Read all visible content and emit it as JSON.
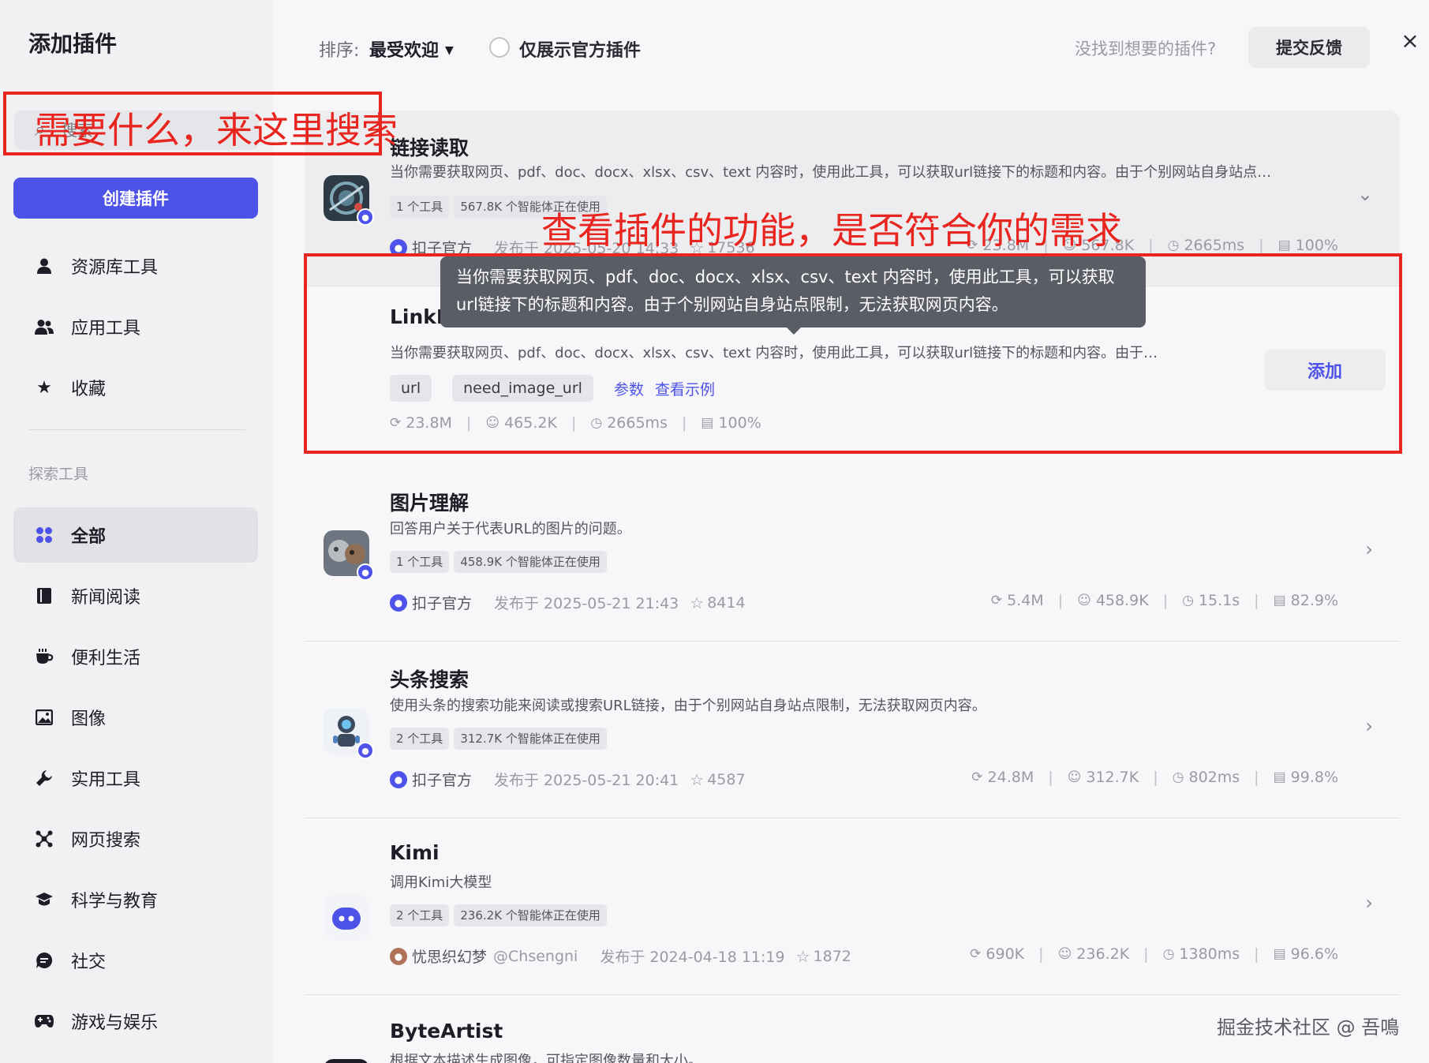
{
  "sidebar": {
    "title": "添加插件",
    "search_placeholder": "搜索",
    "create_button": "创建插件",
    "top_items": [
      {
        "label": "资源库工具",
        "icon": "user-icon"
      },
      {
        "label": "应用工具",
        "icon": "users-icon"
      },
      {
        "label": "收藏",
        "icon": "star-icon"
      }
    ],
    "section_label": "探索工具",
    "categories": [
      {
        "label": "全部",
        "icon": "grid-icon",
        "active": true
      },
      {
        "label": "新闻阅读",
        "icon": "book-icon"
      },
      {
        "label": "便利生活",
        "icon": "cup-icon"
      },
      {
        "label": "图像",
        "icon": "image-icon"
      },
      {
        "label": "实用工具",
        "icon": "wrench-icon"
      },
      {
        "label": "网页搜索",
        "icon": "network-icon"
      },
      {
        "label": "科学与教育",
        "icon": "graduation-cap-icon"
      },
      {
        "label": "社交",
        "icon": "chat-icon"
      },
      {
        "label": "游戏与娱乐",
        "icon": "gamepad-icon"
      }
    ]
  },
  "toolbar": {
    "sort_label": "排序:",
    "sort_value": "最受欢迎",
    "official_only": "仅展示官方插件",
    "not_found": "没找到想要的插件?",
    "feedback": "提交反馈",
    "close": "×"
  },
  "plugins": [
    {
      "title": "链接读取",
      "desc": "当你需要获取网页、pdf、doc、docx、xlsx、csv、text 内容时，使用此工具，可以获取url链接下的标题和内容。由于个别网站自身站点…",
      "tools": "1 个工具",
      "usage": "567.8K 个智能体正在使用",
      "author": "扣子官方",
      "published": "发布于 2025-05-20 14:33",
      "stars": "17536",
      "stats": [
        "23.8M",
        "567.8K",
        "2665ms",
        "100%"
      ],
      "expanded": true
    },
    {
      "title": "图片理解",
      "desc": "回答用户关于代表URL的图片的问题。",
      "tools": "1 个工具",
      "usage": "458.9K 个智能体正在使用",
      "author": "扣子官方",
      "published": "发布于 2025-05-21 21:43",
      "stars": "8414",
      "stats": [
        "5.4M",
        "458.9K",
        "15.1s",
        "82.9%"
      ]
    },
    {
      "title": "头条搜索",
      "desc": "使用头条的搜索功能来阅读或搜索URL链接，由于个别网站自身站点限制，无法获取网页内容。",
      "tools": "2 个工具",
      "usage": "312.7K 个智能体正在使用",
      "author": "扣子官方",
      "published": "发布于 2025-05-21 20:41",
      "stars": "4587",
      "stats": [
        "24.8M",
        "312.7K",
        "802ms",
        "99.8%"
      ]
    },
    {
      "title": "Kimi",
      "desc": "调用Kimi大模型",
      "tools": "2 个工具",
      "usage": "236.2K 个智能体正在使用",
      "author": "忧思织幻梦",
      "handle": "@Chsengni",
      "published": "发布于 2024-04-18 11:19",
      "stars": "1872",
      "stats": [
        "690K",
        "236.2K",
        "1380ms",
        "96.6%"
      ]
    },
    {
      "title": "ByteArtist",
      "desc": "根据文本描述生成图像，可指定图像数量和大小。"
    }
  ],
  "tool": {
    "title": "LinkReaderPlugin",
    "desc": "当你需要获取网页、pdf、doc、docx、xlsx、csv、text 内容时，使用此工具，可以获取url链接下的标题和内容。由于…",
    "params": [
      "url",
      "need_image_url"
    ],
    "params_link": "参数",
    "example_link": "查看示例",
    "stats": [
      "23.8M",
      "465.2K",
      "2665ms",
      "100%"
    ],
    "add_button": "添加"
  },
  "tooltip": "当你需要获取网页、pdf、doc、docx、xlsx、csv、text 内容时，使用此工具，可以获取url链接下的标题和内容。由于个别网站自身站点限制，无法获取网页内容。",
  "annotations": {
    "search_hint": "需要什么，来这里搜索",
    "feature_hint": "查看插件的功能，是否符合你的需求",
    "color": "#e8251f"
  },
  "watermark": "掘金技术社区 @ 吾鳴",
  "colors": {
    "accent": "#4d53e8",
    "annotation": "#e8251f"
  }
}
